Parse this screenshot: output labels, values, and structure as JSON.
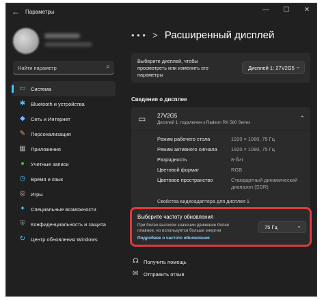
{
  "window": {
    "app_title": "Параметры",
    "back_glyph": "←",
    "minimize_glyph": "—",
    "maximize_glyph": "☐",
    "close_glyph": "✕"
  },
  "search": {
    "placeholder": "Найти параметр"
  },
  "sidebar": {
    "items": [
      {
        "label": "Система",
        "icon": "monitor-icon",
        "glyph": "▭",
        "color": "#4cc2ff",
        "active": true
      },
      {
        "label": "Bluetooth и устройства",
        "icon": "bluetooth-icon",
        "glyph": "✱",
        "color": "#4cc2ff"
      },
      {
        "label": "Сеть и Интернет",
        "icon": "wifi-icon",
        "glyph": "◆",
        "color": "#7fb2ff"
      },
      {
        "label": "Персонализация",
        "icon": "brush-icon",
        "glyph": "✎",
        "color": "#f0a060"
      },
      {
        "label": "Приложения",
        "icon": "apps-icon",
        "glyph": "▦",
        "color": "#b0b0b0"
      },
      {
        "label": "Учетные записи",
        "icon": "account-icon",
        "glyph": "●",
        "color": "#4caf50"
      },
      {
        "label": "Время и язык",
        "icon": "globe-clock-icon",
        "glyph": "◷",
        "color": "#4cc2ff"
      },
      {
        "label": "Игры",
        "icon": "gamepad-icon",
        "glyph": "◎",
        "color": "#b0b0b0"
      },
      {
        "label": "Специальные возможности",
        "icon": "accessibility-icon",
        "glyph": "✦",
        "color": "#4cc2ff"
      },
      {
        "label": "Конфиденциальность и защита",
        "icon": "shield-icon",
        "glyph": "⛨",
        "color": "#9a9a9a"
      },
      {
        "label": "Центр обновления Windows",
        "icon": "update-icon",
        "glyph": "↻",
        "color": "#4cc2ff"
      }
    ]
  },
  "breadcrumb": {
    "dots": "• • •",
    "separator": ">",
    "title": "Расширенный дисплей"
  },
  "select_display": {
    "text": "Выберите дисплей, чтобы просмотреть или изменить его параметры",
    "value": "Дисплей 1: 27V2G5"
  },
  "display_info": {
    "section_title": "Сведения о дисплее",
    "name": "27V2G5",
    "subtitle": "Дисплей 1: подключен к Radeon RX 580 Series",
    "rows": [
      {
        "key": "Режим рабочего стола",
        "value": "1920 × 1080, 75 Гц"
      },
      {
        "key": "Режим активного сигнала",
        "value": "1920 × 1080, 75 Гц"
      },
      {
        "key": "Разрядность",
        "value": "8-бит"
      },
      {
        "key": "Цветовой формат",
        "value": "RGB"
      },
      {
        "key": "Цветовое пространство",
        "value": "Стандартный динамический диапазон (SDR)"
      }
    ],
    "adapter_link": "Свойства видеоадаптера для дисплея 1"
  },
  "refresh_rate": {
    "title": "Выберите частоту обновления",
    "description": "При более высоком значении движение более плавное, но используется больше энергии",
    "link": "Подробнее о частоте обновления",
    "value": "75 Гц"
  },
  "help": {
    "get_help": "Получить помощь",
    "feedback": "Отправить отзыв"
  },
  "colors": {
    "accent": "#4cc2ff",
    "highlight_border": "#e03a3a",
    "background": "#202020"
  }
}
